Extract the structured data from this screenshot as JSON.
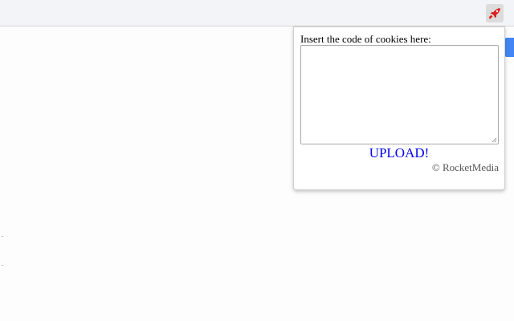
{
  "toolbar": {
    "extension_icon": "rocket-icon"
  },
  "popup": {
    "label": "Insert the code of cookies here:",
    "textarea_value": "",
    "upload_label": "UPLOAD!",
    "copyright": "© RocketMedia"
  },
  "colors": {
    "link": "#0000ee",
    "icon_red": "#e02020",
    "accent_blue": "#4285f4"
  }
}
